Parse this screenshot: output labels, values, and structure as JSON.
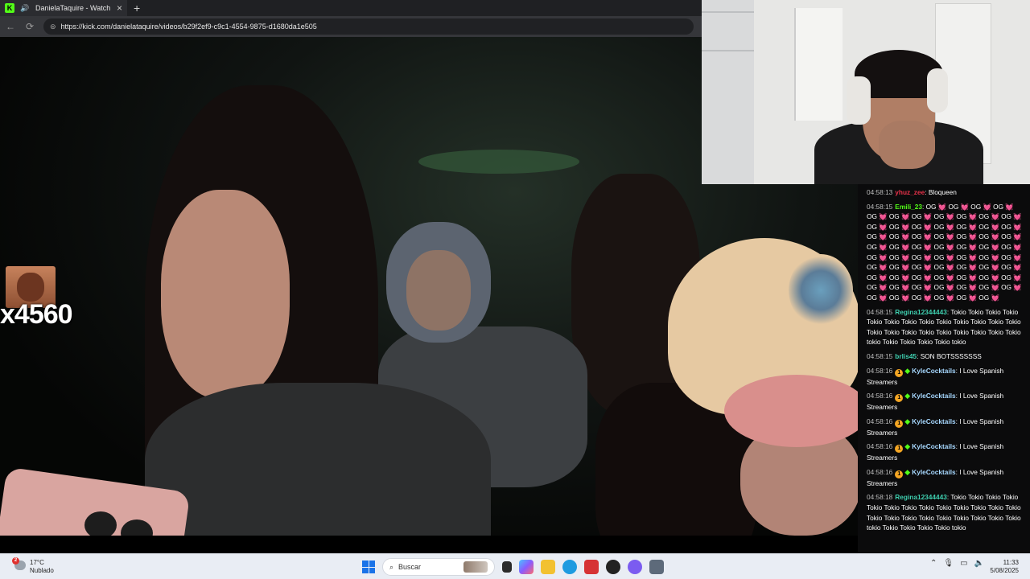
{
  "browser": {
    "tab_title": "DanielaTaquire - Watch the V",
    "new_tab_symbol": "+",
    "url": "https://kick.com/danielataquire/videos/b29f2ef9-c9c1-4554-9875-d1680da1e505"
  },
  "overlay": {
    "counter": "x4560"
  },
  "chat": {
    "messages": [
      {
        "time": "04:58:13",
        "user": "yhuz_zee",
        "user_color": "#e8324a",
        "text": "Bloqueen"
      },
      {
        "time": "04:58:15",
        "user": "Emili_23",
        "user_color": "#53fc18",
        "text": "OG 💓 OG 💓 OG 💓 OG 💓 OG 💓 OG 💓 OG 💓 OG 💓 OG 💓 OG 💓 OG 💓 OG 💓 OG 💓 OG 💓 OG 💓 OG 💓 OG 💓 OG 💓 OG 💓 OG 💓 OG 💓 OG 💓 OG 💓 OG 💓 OG 💓 OG 💓 OG 💓 OG 💓 OG 💓 OG 💓 OG 💓 OG 💓 OG 💓 OG 💓 OG 💓 OG 💓 OG 💓 OG 💓 OG 💓 OG 💓 OG 💓 OG 💓 OG 💓 OG 💓 OG 💓 OG 💓 OG 💓 OG 💓 OG 💓 OG 💓 OG 💓 OG 💓 OG 💓 OG 💓 OG 💓 OG 💓 OG 💓 OG 💓 OG 💓 OG 💓 OG 💓 OG 💓 OG 💓 OG 💓 OG 💓 OG 💓"
      },
      {
        "time": "04:58:15",
        "user": "Regina12344443",
        "user_color": "#3fd0b0",
        "text": "Tokio Tokio Tokio Tokio Tokio Tokio Tokio Tokio Tokio Tokio Tokio Tokio Tokio Tokio Tokio Tokio Tokio Tokio Tokio Tokio Tokio Tokio tokio Tokio Tokio Tokio Tokio tokio"
      },
      {
        "time": "04:58:15",
        "user": "brlis45",
        "user_color": "#3fd0b0",
        "text": "SON BOTSSSSSSS"
      },
      {
        "time": "04:58:16",
        "user": "KyleCocktails",
        "user_color": "#a7d8ff",
        "badges": true,
        "text": "I Love Spanish Streamers"
      },
      {
        "time": "04:58:16",
        "user": "KyleCocktails",
        "user_color": "#a7d8ff",
        "badges": true,
        "text": "I Love Spanish Streamers"
      },
      {
        "time": "04:58:16",
        "user": "KyleCocktails",
        "user_color": "#a7d8ff",
        "badges": true,
        "text": "I Love Spanish Streamers"
      },
      {
        "time": "04:58:16",
        "user": "KyleCocktails",
        "user_color": "#a7d8ff",
        "badges": true,
        "text": "I Love Spanish Streamers"
      },
      {
        "time": "04:58:16",
        "user": "KyleCocktails",
        "user_color": "#a7d8ff",
        "badges": true,
        "text": "I Love Spanish Streamers"
      },
      {
        "time": "04:58:18",
        "user": "Regina12344443",
        "user_color": "#3fd0b0",
        "text": "Tokio Tokio Tokio Tokio Tokio Tokio Tokio Tokio Tokio Tokio Tokio Tokio Tokio Tokio Tokio Tokio Tokio Tokio Tokio Tokio Tokio Tokio tokio Tokio Tokio Tokio Tokio tokio"
      }
    ]
  },
  "taskbar": {
    "weather_temp": "17°C",
    "weather_desc": "Nublado",
    "weather_badge": "2",
    "search_label": "Buscar",
    "time": "11:33",
    "date": "5/08/2025"
  }
}
